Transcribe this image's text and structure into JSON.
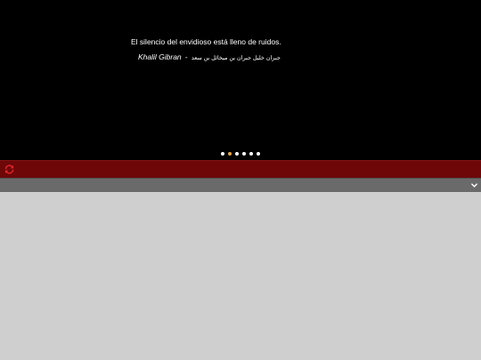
{
  "quote": {
    "text": "El silencio del envidioso está lleno de ruidos.",
    "author": "Khalil Gibran",
    "dash": "-",
    "author_arabic": "جبران خليل جبران بن ميخائل بن سعد"
  },
  "slider": {
    "dot_count": 6,
    "active_index": 1
  },
  "colors": {
    "quote_background": "#000000",
    "accent_bar": "#6d0708",
    "refresh_icon": "#e0262a",
    "toolbar": "#6a6a6a",
    "content_background": "#cfcfcf",
    "active_dot": "#e8a53a"
  },
  "icons": {
    "refresh": "refresh-icon",
    "expand": "chevron-down-icon"
  }
}
